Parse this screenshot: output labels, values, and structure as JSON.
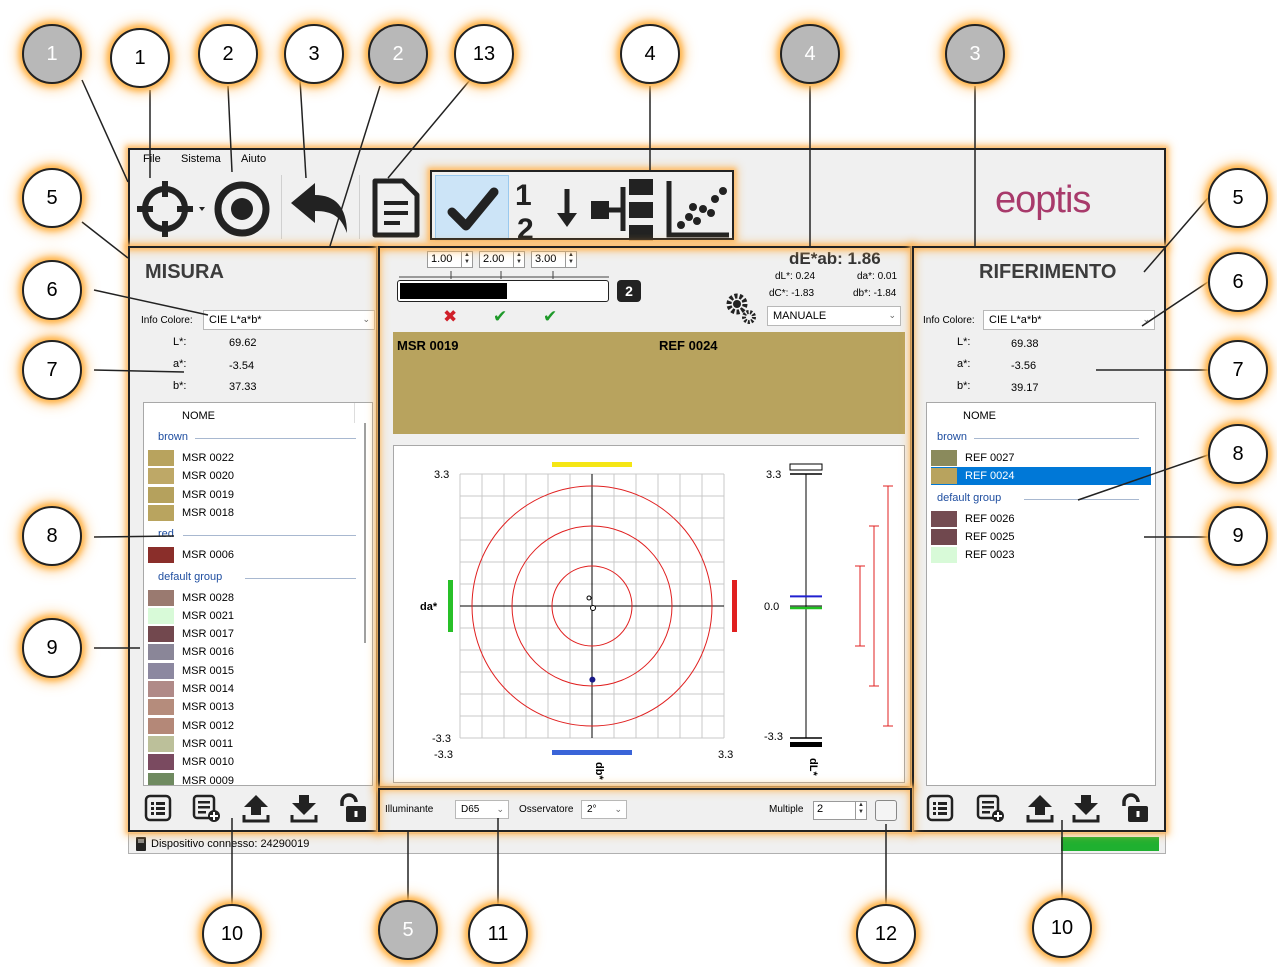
{
  "menu": {
    "file": "File",
    "sistema": "Sistema",
    "aiuto": "Aiuto"
  },
  "brand": {
    "logo_text": "eoptis",
    "color": "#a83a6b"
  },
  "left_panel": {
    "title": "MISURA",
    "info_label": "Info Colore:",
    "info_value": "CIE L*a*b*",
    "lab": [
      {
        "label": "L*:",
        "value": "69.62"
      },
      {
        "label": "a*:",
        "value": "-3.54"
      },
      {
        "label": "b*:",
        "value": "37.33"
      }
    ],
    "column_header": "NOME",
    "groups": [
      {
        "name": "brown",
        "items": [
          {
            "name": "MSR 0022",
            "color": "#b8a35e"
          },
          {
            "name": "MSR 0020",
            "color": "#bea867"
          },
          {
            "name": "MSR 0019",
            "color": "#b5a15d"
          },
          {
            "name": "MSR 0018",
            "color": "#b9a45f"
          }
        ]
      },
      {
        "name": "red",
        "items": [
          {
            "name": "MSR 0006",
            "color": "#8a2e2a"
          }
        ]
      },
      {
        "name": "default group",
        "items": [
          {
            "name": "MSR 0028",
            "color": "#9a7a70"
          },
          {
            "name": "MSR 0021",
            "color": "#d8fad8"
          },
          {
            "name": "MSR 0017",
            "color": "#72484e"
          },
          {
            "name": "MSR 0016",
            "color": "#8a8698"
          },
          {
            "name": "MSR 0015",
            "color": "#8c88a0"
          },
          {
            "name": "MSR 0014",
            "color": "#b08a88"
          },
          {
            "name": "MSR 0013",
            "color": "#b58c7c"
          },
          {
            "name": "MSR 0012",
            "color": "#b48878"
          },
          {
            "name": "MSR 0011",
            "color": "#bcc09a"
          },
          {
            "name": "MSR 0010",
            "color": "#7a4a60"
          },
          {
            "name": "MSR 0009",
            "color": "#6f8a60"
          }
        ]
      }
    ]
  },
  "right_panel": {
    "title": "RIFERIMENTO",
    "info_label": "Info Colore:",
    "info_value": "CIE L*a*b*",
    "lab": [
      {
        "label": "L*:",
        "value": "69.38"
      },
      {
        "label": "a*:",
        "value": "-3.56"
      },
      {
        "label": "b*:",
        "value": "39.17"
      }
    ],
    "column_header": "NOME",
    "groups": [
      {
        "name": "brown",
        "items": [
          {
            "name": "REF 0027",
            "color": "#8a8a5c",
            "selected": false
          },
          {
            "name": "REF 0024",
            "color": "#b8a35e",
            "selected": true
          }
        ]
      },
      {
        "name": "default group",
        "items": [
          {
            "name": "REF 0026",
            "color": "#744c52",
            "selected": false
          },
          {
            "name": "REF 0025",
            "color": "#70484e",
            "selected": false
          },
          {
            "name": "REF 0023",
            "color": "#d8fad8",
            "selected": false
          }
        ]
      }
    ]
  },
  "center": {
    "thresholds": [
      "1.00",
      "2.00",
      "3.00"
    ],
    "tolerance_badge": "2",
    "results": [
      "fail",
      "pass",
      "pass"
    ],
    "de_title": "dE*ab: 1.86",
    "dL": "dL*: 0.24",
    "da": "da*: 0.01",
    "dC": "dC*: -1.83",
    "db": "db*: -1.84",
    "mode": "MANUALE",
    "sample_color": "#b8a35e",
    "msr_label": "MSR 0019",
    "ref_label": "REF 0024"
  },
  "chart_data": [
    {
      "type": "scatter",
      "title": "",
      "xlabel": "db*",
      "ylabel": "da*",
      "xlim": [
        -3.3,
        3.3
      ],
      "ylim": [
        -3.3,
        3.3
      ],
      "tick_labels": {
        "ymax": "3.3",
        "ymin": "-3.3",
        "xmin": "-3.3",
        "xmax": "3.3"
      },
      "tolerance_circles": [
        1.0,
        2.0,
        3.0
      ],
      "points": [
        {
          "name": "reference",
          "x": 0.0,
          "y": 0.0
        },
        {
          "name": "measure",
          "x": -1.84,
          "y": 0.01
        }
      ],
      "grid": true
    },
    {
      "type": "bar",
      "title": "",
      "xlabel": "dL*",
      "ylim": [
        -3.3,
        3.3
      ],
      "tick_labels": {
        "max": "3.3",
        "zero": "0.0",
        "min": "-3.3"
      },
      "value": 0.24,
      "tolerance_ranges": [
        1.0,
        2.0,
        3.0
      ]
    }
  ],
  "footer": {
    "illuminant_label": "Illuminante",
    "illuminant_value": "D65",
    "observer_label": "Osservatore",
    "observer_value": "2°",
    "multiple_label": "Multiple",
    "multiple_value": "2"
  },
  "status": {
    "text": "Dispositivo connesso: 24290019",
    "indicator_color": "#1fb030"
  },
  "callouts": {
    "top": [
      "1",
      "1",
      "2",
      "3",
      "2",
      "13",
      "4",
      "4",
      "3"
    ],
    "left": [
      "5",
      "6",
      "7",
      "8",
      "9"
    ],
    "right": [
      "5",
      "6",
      "7",
      "8",
      "9"
    ],
    "bottom": [
      "10",
      "5",
      "11",
      "12",
      "10"
    ]
  }
}
